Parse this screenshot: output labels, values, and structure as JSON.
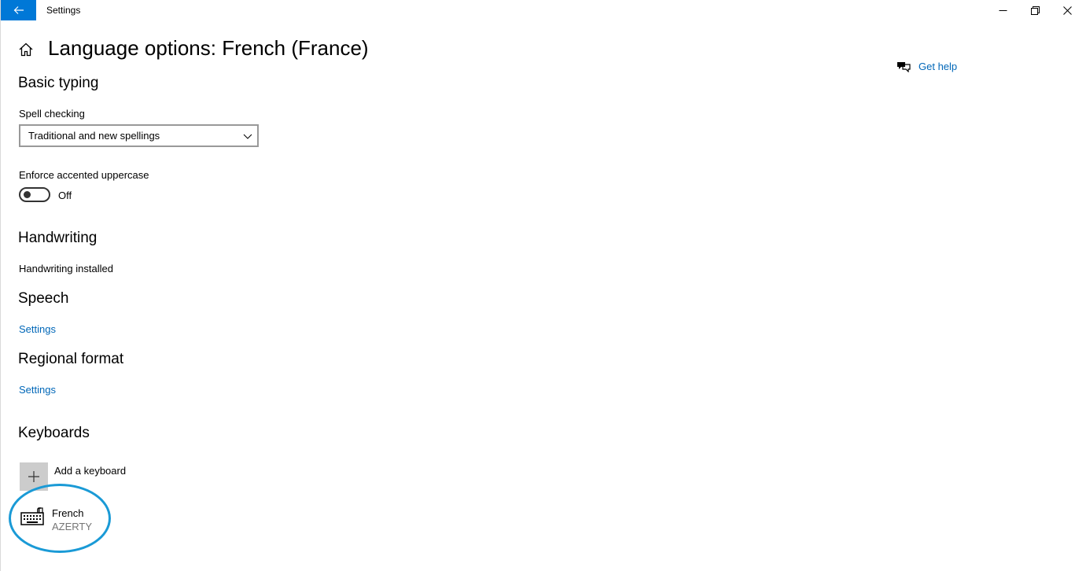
{
  "titlebar": {
    "title": "Settings",
    "back_icon": "back-arrow-icon",
    "accent": "#0078d7"
  },
  "header": {
    "title": "Language options: French (France)",
    "home_icon": "home-icon"
  },
  "help": {
    "label": "Get help",
    "icon": "help-chat-icon"
  },
  "basic_typing": {
    "title": "Basic typing",
    "spell_checking_label": "Spell checking",
    "spell_checking_value": "Traditional and new spellings",
    "enforce_label": "Enforce accented uppercase",
    "toggle_state": "Off"
  },
  "handwriting": {
    "title": "Handwriting",
    "status": "Handwriting installed"
  },
  "speech": {
    "title": "Speech",
    "link": "Settings"
  },
  "regional_format": {
    "title": "Regional format",
    "link": "Settings"
  },
  "keyboards": {
    "title": "Keyboards",
    "add_label": "Add a keyboard",
    "items": [
      {
        "name": "French",
        "layout": "AZERTY",
        "icon": "keyboard-icon"
      }
    ]
  },
  "colors": {
    "link": "#0067b8",
    "highlight": "#1a9ad6"
  }
}
